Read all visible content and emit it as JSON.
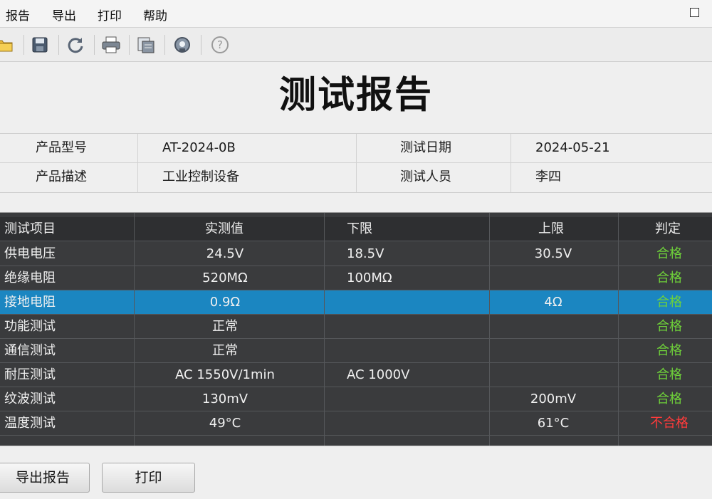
{
  "menu": [
    "报告",
    "导出",
    "打印",
    "帮助"
  ],
  "toolbar": {
    "icons": [
      "open-folder-icon",
      "save-icon",
      "refresh-icon",
      "print-icon",
      "print-preview-icon",
      "settings-icon",
      "help-icon"
    ]
  },
  "title": "测试报告",
  "info": {
    "model_label": "产品型号",
    "model_value": "AT-2024-0B",
    "date_label": "测试日期",
    "date_value": "2024-05-21",
    "desc_label": "产品描述",
    "desc_value": "工业控制设备",
    "tester_label": "测试人员",
    "tester_value": "李四"
  },
  "results": {
    "headers": [
      "测试项目",
      "实测值",
      "下限",
      "上限",
      "判定"
    ],
    "rows": [
      {
        "item": "供电电压",
        "measured": "24.5V",
        "lower": "18.5V",
        "upper": "30.5V",
        "verdict": "合格",
        "pass": true
      },
      {
        "item": "绝缘电阻",
        "measured": "520MΩ",
        "lower": "100MΩ",
        "upper": "",
        "verdict": "合格",
        "pass": true
      },
      {
        "item": "接地电阻",
        "measured": "0.9Ω",
        "lower": "",
        "upper": "4Ω",
        "verdict": "合格",
        "pass": true,
        "selected": true
      },
      {
        "item": "功能测试",
        "measured": "正常",
        "lower": "",
        "upper": "",
        "verdict": "合格",
        "pass": true
      },
      {
        "item": "通信测试",
        "measured": "正常",
        "lower": "",
        "upper": "",
        "verdict": "合格",
        "pass": true
      },
      {
        "item": "耐压测试",
        "measured": "AC 1550V/1min",
        "lower": "AC 1000V",
        "upper": "",
        "verdict": "合格",
        "pass": true
      },
      {
        "item": "纹波测试",
        "measured": "130mV",
        "lower": "",
        "upper": "200mV",
        "verdict": "合格",
        "pass": true
      },
      {
        "item": "温度测试",
        "measured": "49°C",
        "lower": "",
        "upper": "61°C",
        "verdict": "不合格",
        "pass": false
      }
    ]
  },
  "buttons": {
    "export": "导出报告",
    "print": "打印"
  },
  "colors": {
    "pass": "#6fd23a",
    "fail": "#ff3b3b",
    "selection": "#1b86c1",
    "grid_bg": "#3a3b3d"
  }
}
